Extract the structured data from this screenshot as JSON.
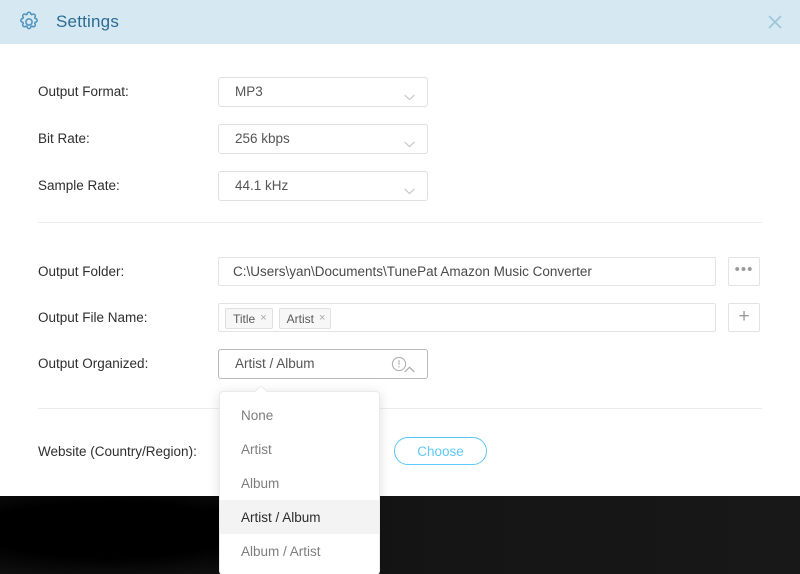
{
  "window": {
    "title": "Settings",
    "gear_icon": "gear-icon",
    "close_icon": "close-icon",
    "header_color": "#d6e9f3",
    "title_color": "#2b6b92",
    "accent_color": "#5ec8f7"
  },
  "form": {
    "output_format": {
      "label": "Output Format:",
      "value": "MP3",
      "chevron": "chevron-down-icon"
    },
    "bit_rate": {
      "label": "Bit Rate:",
      "value": "256 kbps",
      "chevron": "chevron-down-icon"
    },
    "sample_rate": {
      "label": "Sample Rate:",
      "value": "44.1 kHz",
      "chevron": "chevron-down-icon"
    },
    "output_folder": {
      "label": "Output Folder:",
      "value": "C:\\Users\\yan\\Documents\\TunePat Amazon Music Converter",
      "browse_label": "•••",
      "browse_icon": "ellipsis-icon"
    },
    "output_file_name": {
      "label": "Output File Name:",
      "tags": [
        {
          "text": "Title",
          "remove": "×"
        },
        {
          "text": "Artist",
          "remove": "×"
        }
      ],
      "add_label": "+",
      "add_icon": "plus-icon"
    },
    "output_organized": {
      "label": "Output Organized:",
      "value": "Artist / Album",
      "chevron": "chevron-up-icon",
      "info_icon": "info-icon",
      "expanded": true,
      "options": [
        {
          "label": "None",
          "selected": false
        },
        {
          "label": "Artist",
          "selected": false
        },
        {
          "label": "Album",
          "selected": false
        },
        {
          "label": "Artist / Album",
          "selected": true
        },
        {
          "label": "Album / Artist",
          "selected": false
        }
      ]
    },
    "website": {
      "label": "Website (Country/Region):",
      "choose_label": "Choose"
    }
  }
}
